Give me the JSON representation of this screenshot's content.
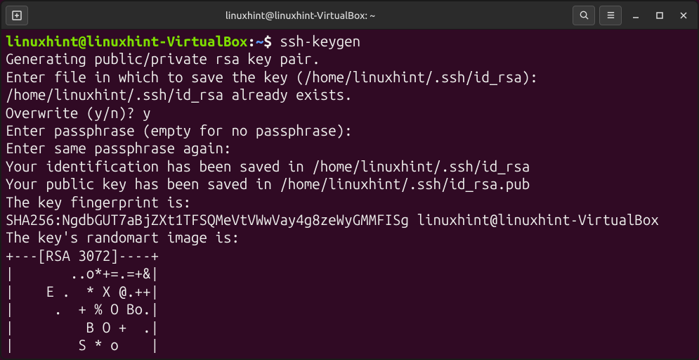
{
  "titlebar": {
    "title": "linuxhint@linuxhint-VirtualBox: ~"
  },
  "prompt": {
    "user_host": "linuxhint@linuxhint-VirtualBox",
    "colon": ":",
    "path": "~",
    "symbol": "$"
  },
  "command": "ssh-keygen",
  "output": {
    "line1": "Generating public/private rsa key pair.",
    "line2": "Enter file in which to save the key (/home/linuxhint/.ssh/id_rsa):",
    "line3": "/home/linuxhint/.ssh/id_rsa already exists.",
    "line4": "Overwrite (y/n)? y",
    "line5": "Enter passphrase (empty for no passphrase):",
    "line6": "Enter same passphrase again:",
    "line7": "Your identification has been saved in /home/linuxhint/.ssh/id_rsa",
    "line8": "Your public key has been saved in /home/linuxhint/.ssh/id_rsa.pub",
    "line9": "The key fingerprint is:",
    "line10": "SHA256:NgdbGUT7aBjZXt1TFSQMeVtVWwVay4g8zeWyGMMFISg linuxhint@linuxhint-VirtualBox",
    "line11": "The key's randomart image is:",
    "line12": "+---[RSA 3072]----+",
    "line13": "|       ..o*+=.=+&|",
    "line14": "|    E .  * X @.++|",
    "line15": "|     .  + % O Bo.|",
    "line16": "|         B O +  .|",
    "line17": "|        S * o    |"
  }
}
